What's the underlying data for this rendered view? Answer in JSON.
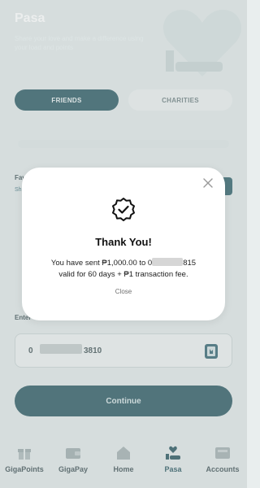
{
  "header": {
    "title": "Pasa",
    "subtitle": "Share your love and make a difference using your load and points"
  },
  "tabs": [
    {
      "label": "FRIENDS",
      "active": true
    },
    {
      "label": "CHARITIES",
      "active": false
    }
  ],
  "favorites": {
    "label": "Fav",
    "link": "Sh"
  },
  "enter_number": {
    "label": "Enter",
    "value_prefix": "0",
    "value_suffix": "3810"
  },
  "continue_label": "Continue",
  "nav": [
    {
      "label": "GigaPoints",
      "icon": "gift-icon",
      "active": false
    },
    {
      "label": "GigaPay",
      "icon": "wallet-icon",
      "active": false
    },
    {
      "label": "Home",
      "icon": "home-icon",
      "active": false
    },
    {
      "label": "Pasa",
      "icon": "heart-hand-icon",
      "active": true
    },
    {
      "label": "Accounts",
      "icon": "sim-card-icon",
      "active": false
    }
  ],
  "modal": {
    "title": "Thank You!",
    "message_part1": "You have sent ₱1,000.00 to 0",
    "message_part2": "815",
    "message_line2": "valid for 60 days + ₱1 transaction fee.",
    "close_label": "Close",
    "close_icon": "close-icon",
    "badge_icon": "verified-check-icon"
  },
  "colors": {
    "accent": "#426b73",
    "modal_bg": "#ffffff",
    "title": "#111111"
  }
}
